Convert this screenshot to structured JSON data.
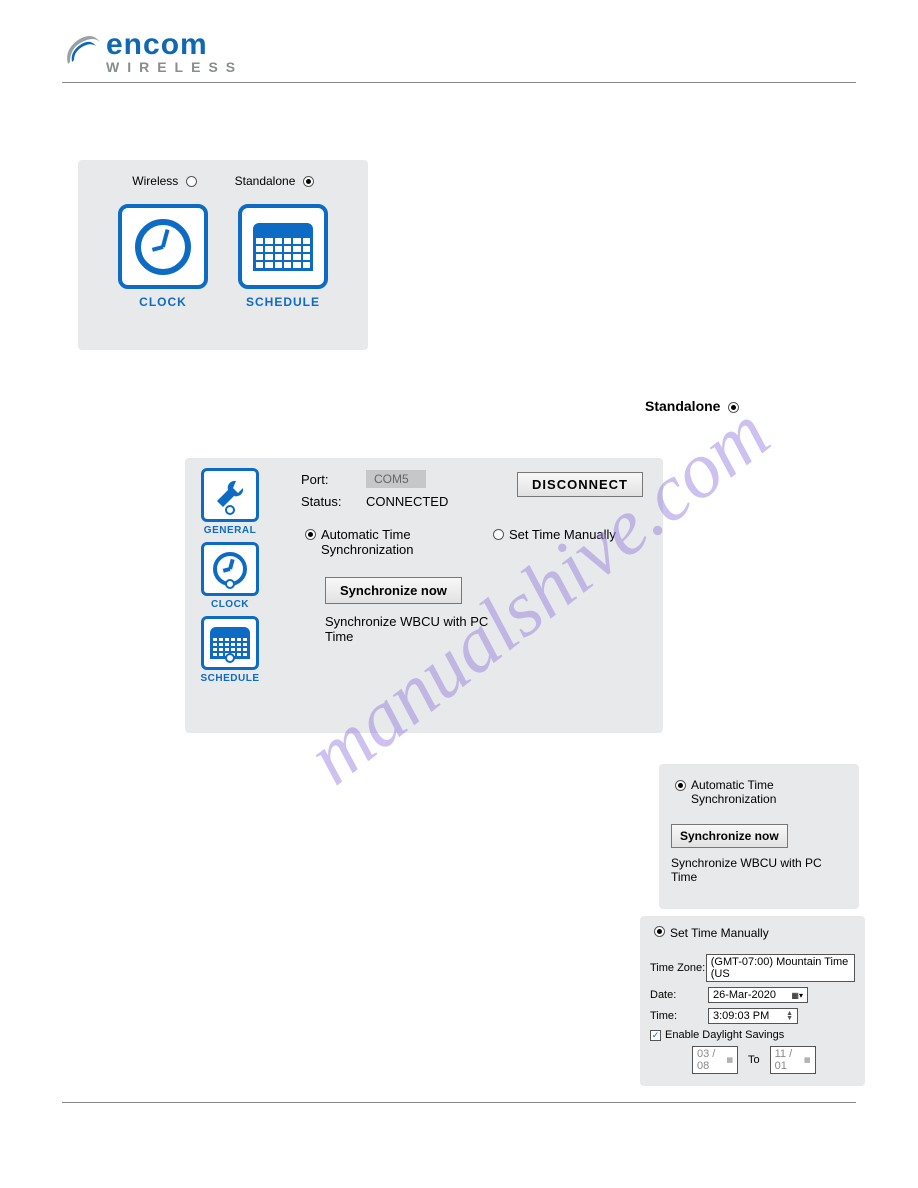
{
  "brand": {
    "name": "encom",
    "sub": "WIRELESS"
  },
  "watermark": "manualshive.com",
  "mode": {
    "wireless_label": "Wireless",
    "standalone_label": "Standalone"
  },
  "tiles": {
    "clock_label": "CLOCK",
    "schedule_label": "SCHEDULE",
    "general_label": "GENERAL"
  },
  "standalone_callout": "Standalone",
  "conn": {
    "port_label": "Port:",
    "port_value": "COM5",
    "status_label": "Status:",
    "status_value": "CONNECTED",
    "disconnect_btn": "DISCONNECT"
  },
  "sync": {
    "auto_label": "Automatic Time Synchronization",
    "manual_label": "Set Time Manually",
    "sync_now_btn": "Synchronize now",
    "desc": "Synchronize WBCU with PC Time"
  },
  "manual": {
    "heading": "Set Time Manually",
    "tz_label": "Time Zone:",
    "tz_value": "(GMT-07:00) Mountain Time (US",
    "date_label": "Date:",
    "date_value": "26-Mar-2020",
    "time_label": "Time:",
    "time_value": "3:09:03 PM",
    "dst_label": "Enable Daylight Savings",
    "dst_from": "03 / 08",
    "dst_to_label": "To",
    "dst_to": "11 / 01"
  }
}
